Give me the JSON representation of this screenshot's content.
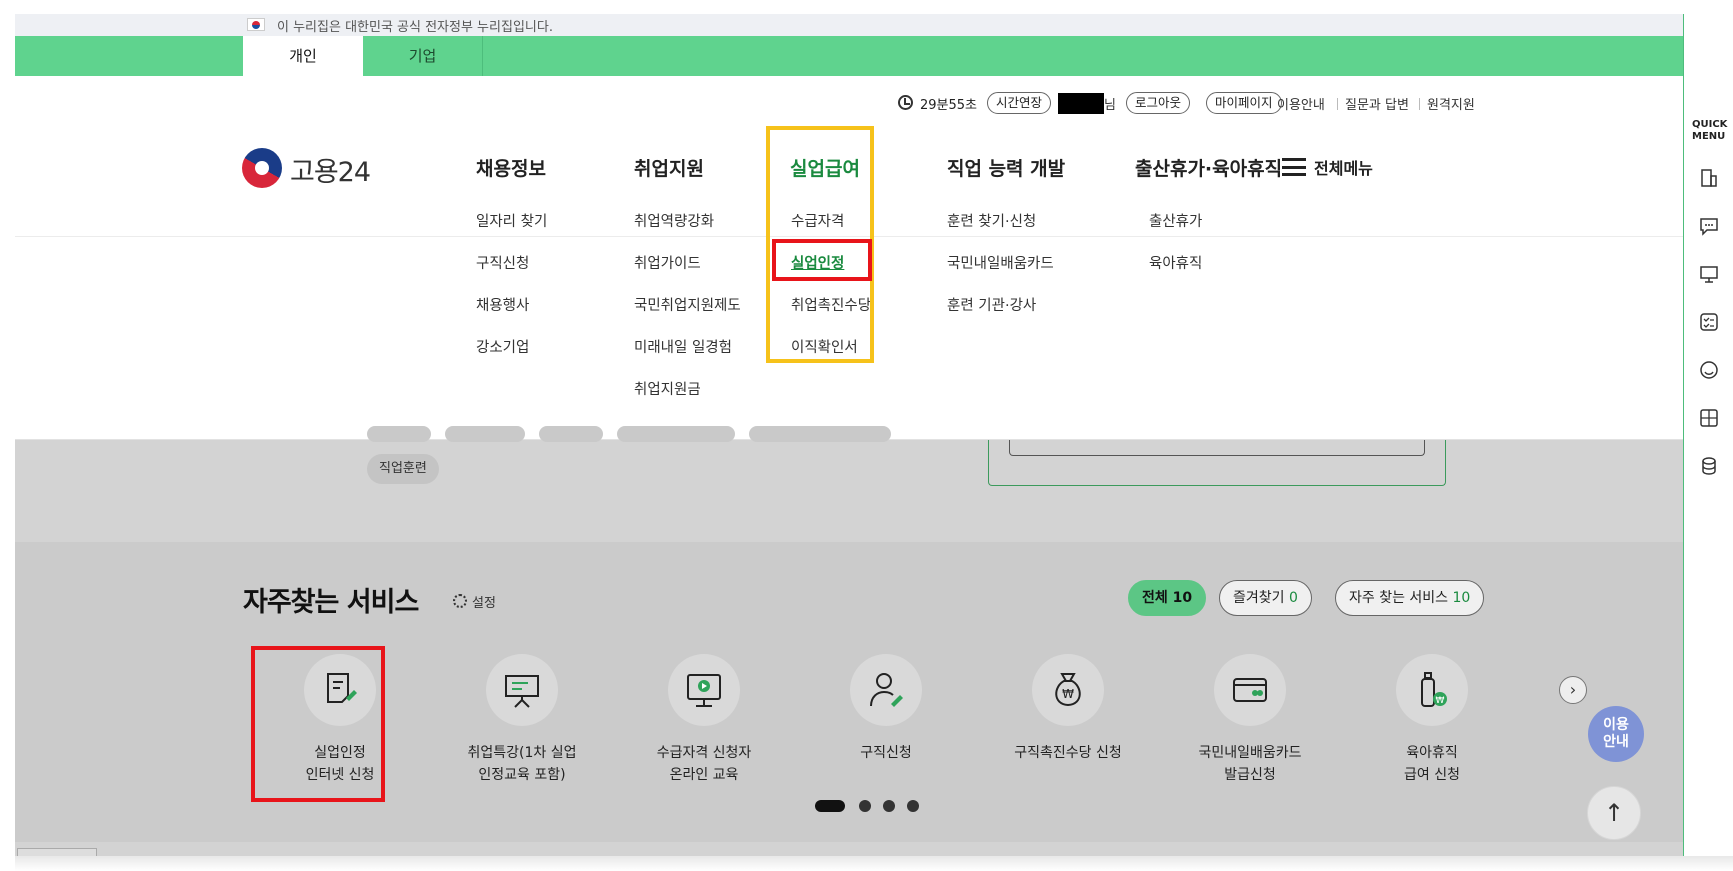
{
  "gov_banner": {
    "text": "이 누리집은 대한민국 공식 전자정부 누리집입니다."
  },
  "user_tabs": [
    {
      "label": "개인",
      "active": true
    },
    {
      "label": "기업",
      "active": false
    }
  ],
  "utility": {
    "timer": "29분55초",
    "extend_label": "시간연장",
    "user_suffix": "님",
    "logout_label": "로그아웃",
    "mypage_label": "마이페이지",
    "links": [
      "이용안내",
      "질문과 답변",
      "원격지원"
    ]
  },
  "logo": {
    "text": "고용24"
  },
  "main_menu": [
    {
      "label": "채용정보",
      "sub": [
        "일자리 찾기",
        "구직신청",
        "채용행사",
        "강소기업"
      ]
    },
    {
      "label": "취업지원",
      "sub": [
        "취업역량강화",
        "취업가이드",
        "국민취업지원제도",
        "미래내일 일경험",
        "취업지원금"
      ]
    },
    {
      "label": "실업급여",
      "active": true,
      "sub": [
        "수급자격",
        "실업인정",
        "취업촉진수당",
        "이직확인서"
      ],
      "current_sub": "실업인정"
    },
    {
      "label": "직업 능력 개발",
      "sub": [
        "훈련 찾기·신청",
        "국민내일배움카드",
        "훈련 기관·강사"
      ]
    },
    {
      "label": "출산휴가·육아휴직",
      "sub": [
        "출산휴가",
        "육아휴직"
      ]
    }
  ],
  "all_menu_label": "전체메뉴",
  "tag_chip": "직업훈련",
  "favorites": {
    "title": "자주찾는 서비스",
    "setting_label": "설정",
    "filters": [
      {
        "label": "전체",
        "count": "10",
        "active": true
      },
      {
        "label": "즐겨찾기",
        "count": "0",
        "active": false
      },
      {
        "label": "자주 찾는 서비스",
        "count": "10",
        "active": false
      }
    ],
    "services": [
      {
        "line1": "실업인정",
        "line2": "인터넷 신청",
        "icon": "document-edit-icon"
      },
      {
        "line1": "취업특강(1차 실업",
        "line2": "인정교육 포함)",
        "icon": "presentation-board-icon"
      },
      {
        "line1": "수급자격 신청자",
        "line2": "온라인 교육",
        "icon": "monitor-play-icon"
      },
      {
        "line1": "구직신청",
        "line2": "",
        "icon": "person-edit-icon"
      },
      {
        "line1": "구직촉진수당 신청",
        "line2": "",
        "icon": "money-bag-icon"
      },
      {
        "line1": "국민내일배움카드",
        "line2": "발급신청",
        "icon": "card-icon"
      },
      {
        "line1": "육아휴직",
        "line2": "급여 신청",
        "icon": "baby-bottle-icon"
      }
    ],
    "pagination": {
      "pages": 4,
      "current": 1
    }
  },
  "floating": {
    "guide_line1": "이용",
    "guide_line2": "안내",
    "top_arrow": "↑",
    "next_arrow": "›"
  },
  "quick_menu": {
    "title_line1": "QUICK",
    "title_line2": "MENU",
    "items": [
      "building-icon",
      "chat-icon",
      "monitor-icon",
      "checklist-icon",
      "smile-icon",
      "calculator-icon",
      "coins-icon"
    ]
  },
  "colors": {
    "accent_green": "#5fd38e",
    "active_text": "#1a8a3f",
    "highlight_yellow": "#f6c21a",
    "highlight_red": "#e8141a",
    "guide_blue": "#7f93d6"
  }
}
